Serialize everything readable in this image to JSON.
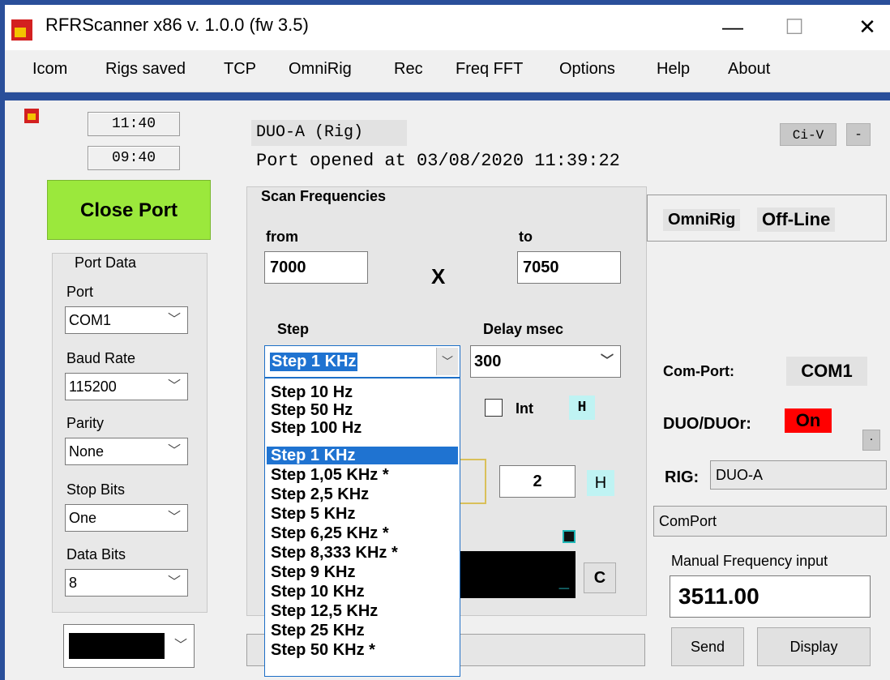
{
  "window": {
    "title": "RFRScanner  x86 v. 1.0.0  (fw 3.5)",
    "minimize": "—",
    "maximize": "☐",
    "close": "✕"
  },
  "menu": [
    "Icom",
    "Rigs saved",
    "TCP",
    "OmniRig",
    "Rec",
    "Freq FFT",
    "Options",
    "Help",
    "About"
  ],
  "clocks": {
    "time1": "11:40",
    "time2": "09:40"
  },
  "close_port": "Close Port",
  "port_data": {
    "title": "Port Data",
    "port_label": "Port",
    "port_value": "COM1",
    "baud_label": "Baud Rate",
    "baud_value": "115200",
    "parity_label": "Parity",
    "parity_value": "None",
    "stopbits_label": "Stop Bits",
    "stopbits_value": "One",
    "databits_label": "Data Bits",
    "databits_value": "8"
  },
  "rig_header": {
    "rig_name": "DUO-A (Rig)",
    "status_line": "Port opened at 03/08/2020 11:39:22",
    "civ_label": "Ci-V",
    "minus": "-"
  },
  "scan": {
    "title": "Scan Frequencies",
    "from_label": "from",
    "to_label": "to",
    "from_value": "7000",
    "to_value": "7050",
    "x_label": "X",
    "step_label": "Step",
    "delay_label": "Delay  msec",
    "step_value": "Step 1 KHz",
    "delay_value": "300",
    "int_label": "Int",
    "h_label": "H",
    "count_value": "2",
    "h2_label": "H",
    "c_label": "C",
    "underscore": "_"
  },
  "step_options": [
    "Step 10 Hz",
    "Step 50 Hz",
    "Step 100 Hz",
    "Step 1 KHz",
    "Step 1,05 KHz *",
    "Step 2,5 KHz",
    "Step 5 KHz",
    "Step 6,25 KHz *",
    "Step 8,333 KHz *",
    "Step 9 KHz",
    "Step 10 KHz",
    "Step 12,5 KHz",
    "Step 25 KHz",
    "Step 50 KHz *"
  ],
  "step_selected_index": 3,
  "right_panel": {
    "omnirig_label": "OmniRig",
    "omnirig_status": "Off-Line",
    "comport_label": "Com-Port:",
    "comport_value": "COM1",
    "duo_label": "DUO/DUOr:",
    "duo_value": "On",
    "dot_btn": ".",
    "rig_label": "RIG:",
    "rig_value": "DUO-A",
    "comport_field": "ComPort",
    "manual_label": "Manual Frequency input",
    "manual_value": "3511.00",
    "send_label": "Send",
    "display_label": "Display"
  },
  "colors": {
    "accent_green": "#9be83c",
    "on_red": "#ff0000",
    "selection_blue": "#1f73d1",
    "frame_blue": "#2a4f9a"
  }
}
